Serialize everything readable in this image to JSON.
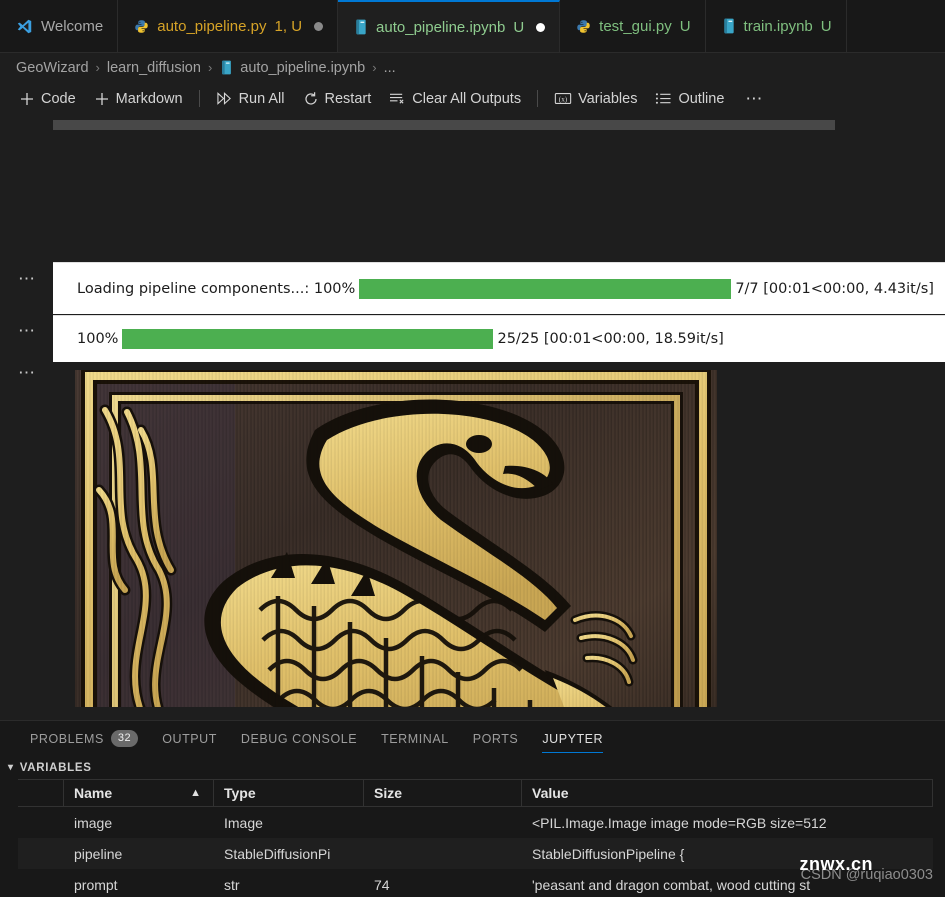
{
  "tabs": [
    {
      "label": "Welcome",
      "icon": "vscode-logo-icon",
      "kind": "welcome",
      "active": false,
      "dirty": false,
      "badge": ""
    },
    {
      "label": "auto_pipeline.py",
      "icon": "python-file-icon",
      "kind": "python",
      "active": false,
      "dirty": true,
      "badge": "1, U"
    },
    {
      "label": "auto_pipeline.ipynb",
      "icon": "notebook-file-icon",
      "kind": "notebook",
      "active": true,
      "dirty": true,
      "badge": "U"
    },
    {
      "label": "test_gui.py",
      "icon": "python-file-icon",
      "kind": "python",
      "active": false,
      "dirty": false,
      "badge": "U"
    },
    {
      "label": "train.ipynb",
      "icon": "notebook-file-icon",
      "kind": "notebook",
      "active": false,
      "dirty": false,
      "badge": "U"
    }
  ],
  "breadcrumb": {
    "items": [
      "GeoWizard",
      "learn_diffusion",
      "auto_pipeline.ipynb",
      "..."
    ],
    "separator": "›"
  },
  "notebook_toolbar": {
    "code": "Code",
    "markdown": "Markdown",
    "run_all": "Run All",
    "restart": "Restart",
    "clear_all_outputs": "Clear All Outputs",
    "variables": "Variables",
    "outline": "Outline",
    "more": "⋯"
  },
  "outputs": {
    "cell1": {
      "label": "Loading pipeline components...: 100%",
      "percent": 100,
      "stats": "7/7 [00:01<00:00, 4.43it/s]"
    },
    "cell2": {
      "label": "100%",
      "percent": 100,
      "stats": "25/25 [00:01<00:00, 18.59it/s]"
    },
    "image": {
      "alt": "generated-wood-carving-dragon-image"
    }
  },
  "panel": {
    "tabs": [
      {
        "label": "PROBLEMS",
        "badge": "32",
        "active": false
      },
      {
        "label": "OUTPUT",
        "badge": "",
        "active": false
      },
      {
        "label": "DEBUG CONSOLE",
        "badge": "",
        "active": false
      },
      {
        "label": "TERMINAL",
        "badge": "",
        "active": false
      },
      {
        "label": "PORTS",
        "badge": "",
        "active": false
      },
      {
        "label": "JUPYTER",
        "badge": "",
        "active": true
      }
    ],
    "variables_section": {
      "title": "VARIABLES",
      "collapsed": false,
      "columns": [
        "Name",
        "Type",
        "Size",
        "Value"
      ],
      "sort_indicator": "▲",
      "rows": [
        {
          "name": "image",
          "type": "Image",
          "size": "",
          "value": "<PIL.Image.Image image mode=RGB size=512"
        },
        {
          "name": "pipeline",
          "type": "StableDiffusionPi",
          "size": "",
          "value": "StableDiffusionPipeline {"
        },
        {
          "name": "prompt",
          "type": "str",
          "size": "74",
          "value": "'peasant and dragon combat, wood cutting st"
        }
      ]
    }
  },
  "watermark": {
    "csdn": "CSDN @ruqiao0303",
    "site": "znwx.cn"
  },
  "colors": {
    "accent": "#0078d4",
    "progress_green": "#4caf50",
    "python_tab": "#d6a327",
    "notebook_tab": "#7fbf7f",
    "editor_bg": "#1e1e1e",
    "panel_bg": "#181818"
  }
}
